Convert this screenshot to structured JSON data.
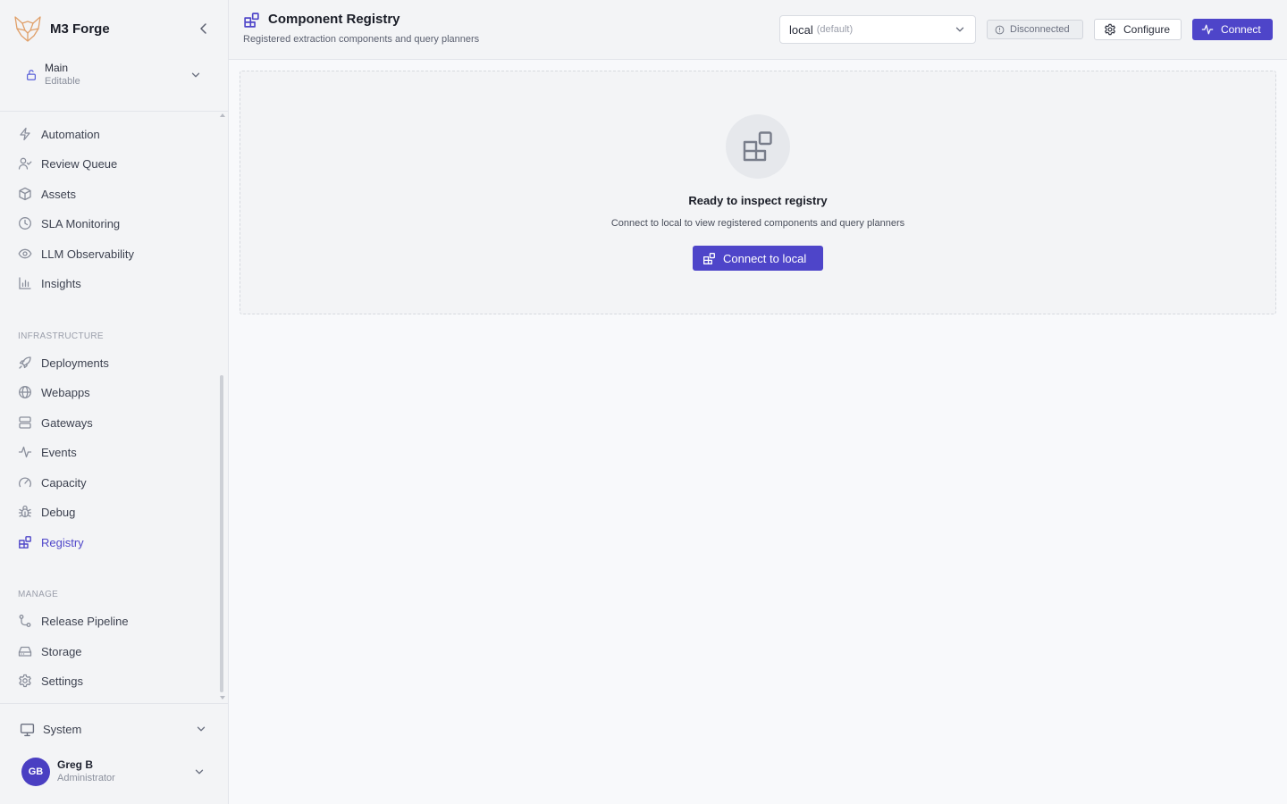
{
  "app": {
    "name": "M3 Forge"
  },
  "branch": {
    "name": "Main",
    "mode": "Editable"
  },
  "sidebar": {
    "items": [
      {
        "label": "Automation",
        "icon": "zap-icon"
      },
      {
        "label": "Review Queue",
        "icon": "user-check-icon"
      },
      {
        "label": "Assets",
        "icon": "package-icon"
      },
      {
        "label": "SLA Monitoring",
        "icon": "clock-icon"
      },
      {
        "label": "LLM Observability",
        "icon": "eye-icon"
      },
      {
        "label": "Insights",
        "icon": "bar-chart-icon"
      }
    ],
    "infrastructure": {
      "label": "INFRASTRUCTURE",
      "items": [
        {
          "label": "Deployments",
          "icon": "rocket-icon"
        },
        {
          "label": "Webapps",
          "icon": "globe-icon"
        },
        {
          "label": "Gateways",
          "icon": "server-icon"
        },
        {
          "label": "Events",
          "icon": "activity-icon"
        },
        {
          "label": "Capacity",
          "icon": "gauge-icon"
        },
        {
          "label": "Debug",
          "icon": "bug-icon"
        },
        {
          "label": "Registry",
          "icon": "blocks-icon",
          "active": true
        }
      ]
    },
    "manage": {
      "label": "MANAGE",
      "items": [
        {
          "label": "Release Pipeline",
          "icon": "git-branch-icon"
        },
        {
          "label": "Storage",
          "icon": "hard-drive-icon"
        },
        {
          "label": "Settings",
          "icon": "gear-icon"
        }
      ]
    },
    "system": {
      "label": "System"
    },
    "user": {
      "initials": "GB",
      "name": "Greg B",
      "role": "Administrator"
    }
  },
  "header": {
    "title": "Component Registry",
    "subtitle": "Registered extraction components and query planners",
    "environment": {
      "value": "local",
      "hint": "(default)"
    },
    "status": "Disconnected",
    "configure_label": "Configure",
    "connect_label": "Connect"
  },
  "empty_state": {
    "title": "Ready to inspect registry",
    "description": "Connect to local to view registered components and query planners",
    "button_label": "Connect to local"
  },
  "colors": {
    "accent": "#4e45c9",
    "sidebar_bg": "#f3f4f6",
    "page_bg": "#f8f9fb"
  }
}
